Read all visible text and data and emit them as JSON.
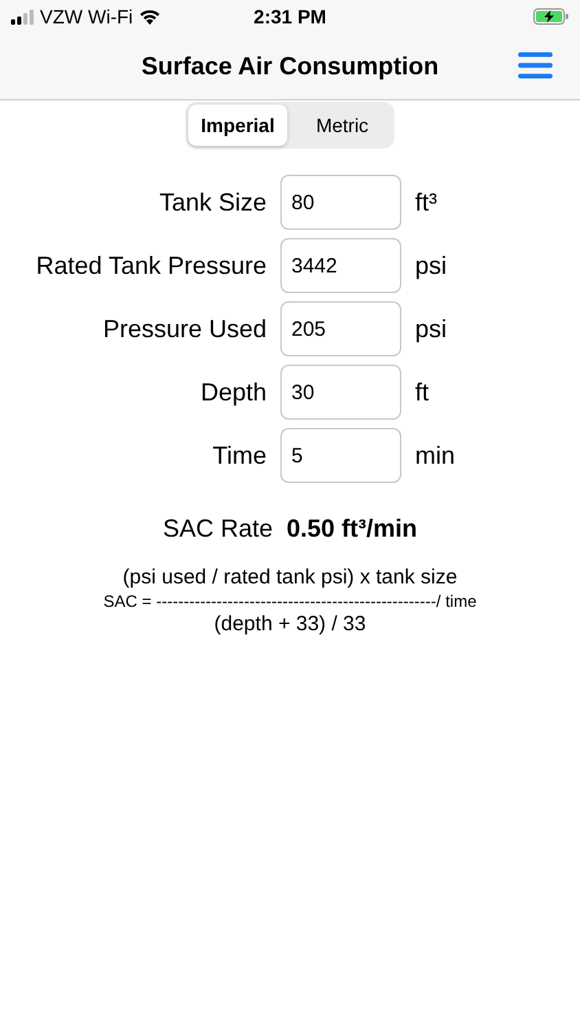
{
  "status_bar": {
    "carrier": "VZW Wi-Fi",
    "time": "2:31 PM"
  },
  "nav": {
    "title": "Surface Air Consumption"
  },
  "units_tabs": [
    {
      "label": "Imperial",
      "selected": true
    },
    {
      "label": "Metric",
      "selected": false
    }
  ],
  "fields": [
    {
      "label": "Tank Size",
      "value": "80",
      "unit": "ft³"
    },
    {
      "label": "Rated Tank Pressure",
      "value": "3442",
      "unit": "psi"
    },
    {
      "label": "Pressure Used",
      "value": "205",
      "unit": "psi"
    },
    {
      "label": "Depth",
      "value": "30",
      "unit": "ft"
    },
    {
      "label": "Time",
      "value": "5",
      "unit": "min"
    }
  ],
  "result": {
    "label": "SAC Rate",
    "value": "0.50 ft³/min"
  },
  "formula": {
    "numerator": "(psi used / rated tank psi) x tank size",
    "middle": "SAC = ---------------------------------------------------/ time",
    "denominator": "(depth + 33) / 33"
  }
}
